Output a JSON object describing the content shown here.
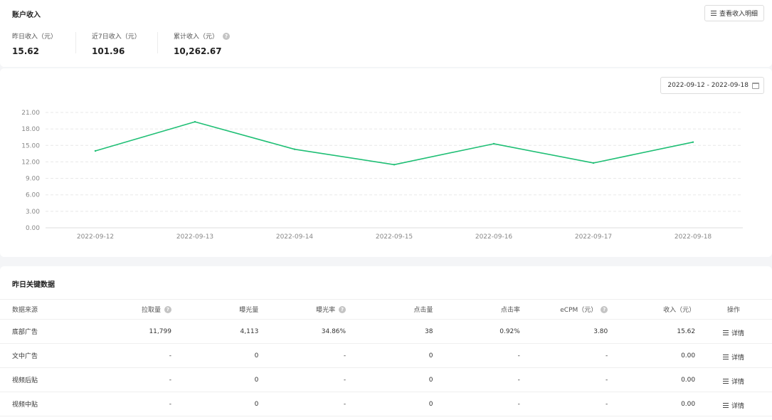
{
  "summary": {
    "title": "账户收入",
    "detail_button": "查看收入明细",
    "stats": [
      {
        "label": "昨日收入（元）",
        "value": "15.62"
      },
      {
        "label": "近7日收入（元）",
        "value": "101.96"
      },
      {
        "label": "累计收入（元）",
        "value": "10,262.67"
      }
    ]
  },
  "chart_card": {
    "date_range": "2022-09-12 - 2022-09-18"
  },
  "chart_data": {
    "type": "line",
    "title": "",
    "xlabel": "",
    "ylabel": "",
    "x": [
      "2022-09-12",
      "2022-09-13",
      "2022-09-14",
      "2022-09-15",
      "2022-09-16",
      "2022-09-17",
      "2022-09-18"
    ],
    "series": [
      {
        "values": [
          14.0,
          19.3,
          14.3,
          11.5,
          15.3,
          11.8,
          15.6
        ]
      }
    ],
    "y_ticks": [
      "0.00",
      "3.00",
      "6.00",
      "9.00",
      "12.00",
      "15.00",
      "18.00",
      "21.00"
    ],
    "ylim": [
      0,
      21
    ],
    "grid": true,
    "line_color": "#1fbf75"
  },
  "table": {
    "title": "昨日关键数据",
    "headers": [
      "数据来源",
      "拉取量",
      "曝光量",
      "曝光率",
      "点击量",
      "点击率",
      "eCPM（元）",
      "收入（元）",
      "操作"
    ],
    "detail_label": "详情",
    "rows": [
      {
        "source": "底部广告",
        "pull": "11,799",
        "impressions": "4,113",
        "imp_rate": "34.86%",
        "clicks": "38",
        "ctr": "0.92%",
        "ecpm": "3.80",
        "revenue": "15.62"
      },
      {
        "source": "文中广告",
        "pull": "-",
        "impressions": "0",
        "imp_rate": "-",
        "clicks": "0",
        "ctr": "-",
        "ecpm": "-",
        "revenue": "0.00"
      },
      {
        "source": "视频后贴",
        "pull": "-",
        "impressions": "0",
        "imp_rate": "-",
        "clicks": "0",
        "ctr": "-",
        "ecpm": "-",
        "revenue": "0.00"
      },
      {
        "source": "视频中贴",
        "pull": "-",
        "impressions": "0",
        "imp_rate": "-",
        "clicks": "0",
        "ctr": "-",
        "ecpm": "-",
        "revenue": "0.00"
      }
    ]
  }
}
